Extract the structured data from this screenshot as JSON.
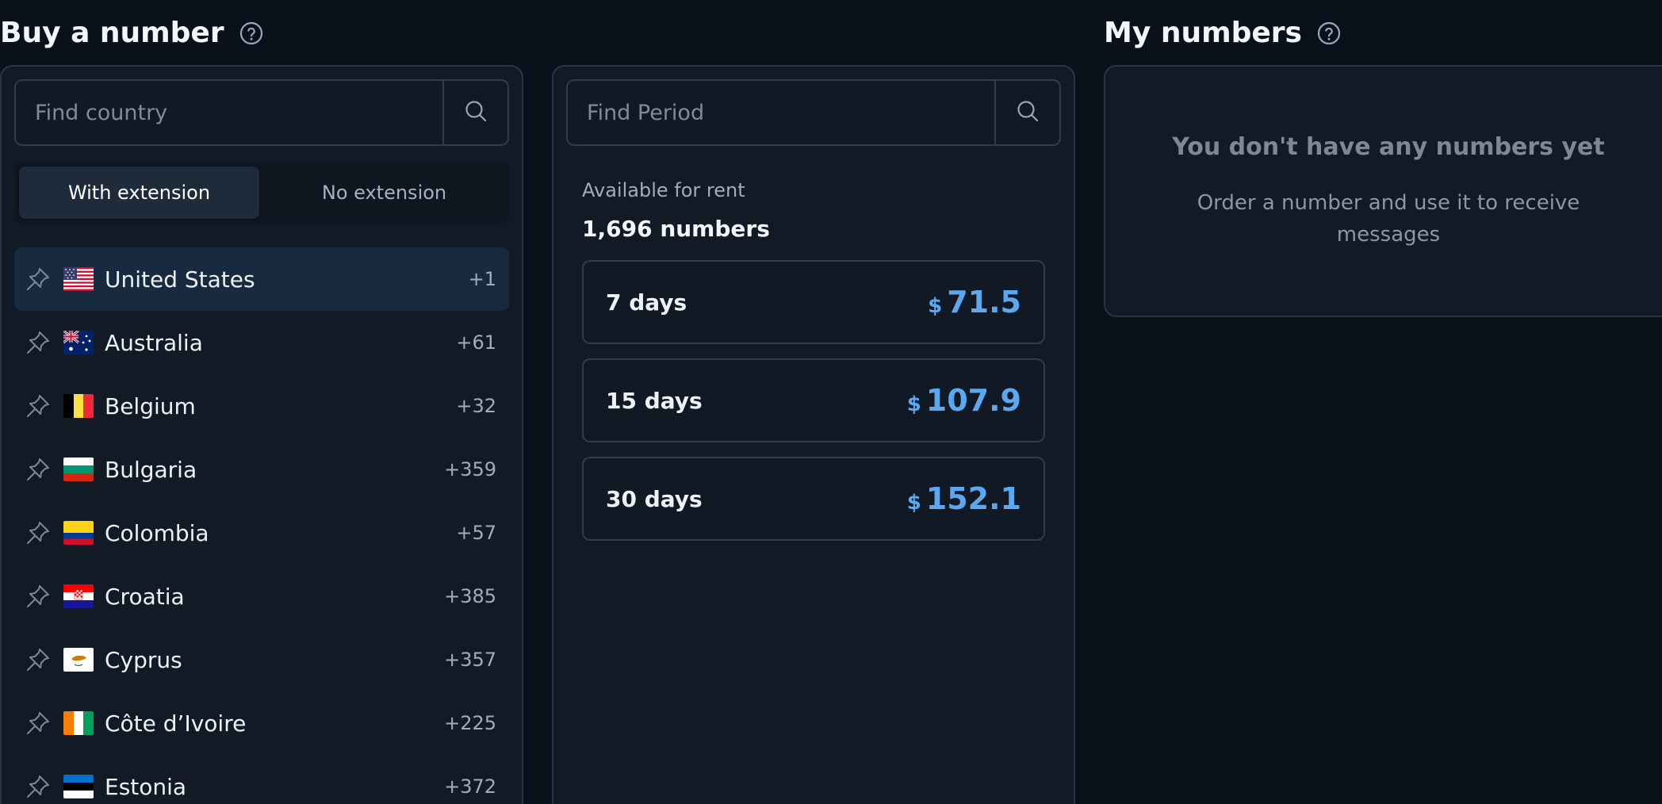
{
  "buy": {
    "title": "Buy a number",
    "country_search_placeholder": "Find country",
    "tabs": [
      "With extension",
      "No extension"
    ],
    "countries": [
      {
        "name": "United States",
        "code": "+1"
      },
      {
        "name": "Australia",
        "code": "+61"
      },
      {
        "name": "Belgium",
        "code": "+32"
      },
      {
        "name": "Bulgaria",
        "code": "+359"
      },
      {
        "name": "Colombia",
        "code": "+57"
      },
      {
        "name": "Croatia",
        "code": "+385"
      },
      {
        "name": "Cyprus",
        "code": "+357"
      },
      {
        "name": "Côte d’Ivoire",
        "code": "+225"
      },
      {
        "name": "Estonia",
        "code": "+372"
      }
    ]
  },
  "period": {
    "search_placeholder": "Find Period",
    "available_label": "Available for rent",
    "available_count": "1,696 numbers",
    "options": [
      {
        "label": "7 days",
        "currency": "$",
        "price": "71.5"
      },
      {
        "label": "15 days",
        "currency": "$",
        "price": "107.9"
      },
      {
        "label": "30 days",
        "currency": "$",
        "price": "152.1"
      }
    ]
  },
  "my_numbers": {
    "title": "My numbers",
    "empty_title": "You don't have any numbers yet",
    "empty_desc": "Order a number and use it to receive messages"
  },
  "colors": {
    "background": "#0b111a",
    "panel": "#121a25",
    "border": "#26364a",
    "accent_price": "#5aa8f0",
    "selected_row": "#182a40"
  },
  "icons": {
    "help": "help-circle-icon",
    "search": "search-icon",
    "pin": "pin-icon"
  }
}
